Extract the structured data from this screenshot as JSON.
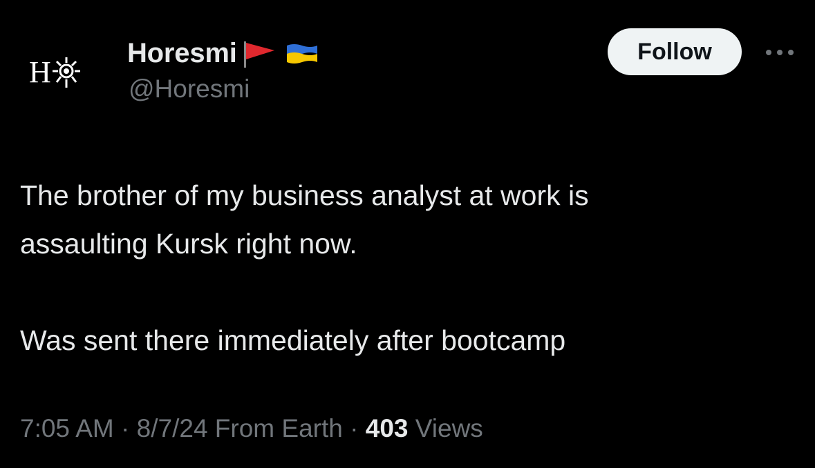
{
  "author": {
    "avatar_letter": "H",
    "display_name": "Horesmi",
    "handle": "@Horesmi",
    "name_emojis": [
      "red-triangular-flag",
      "ukraine-flag"
    ]
  },
  "follow_label": "Follow",
  "post": {
    "line1": "The brother of my business analyst at work is",
    "line2": "assaulting Kursk right now.",
    "line3": "Was sent there immediately after bootcamp"
  },
  "meta": {
    "time": "7:05 AM",
    "sep1": " · ",
    "date": "8/7/24",
    "location": " From Earth",
    "sep2": " · ",
    "views_count": "403",
    "views_label": " Views"
  },
  "colors": {
    "background": "#000000",
    "text_primary": "#e7e9ea",
    "text_secondary": "#71767b",
    "follow_bg": "#eff3f4",
    "follow_text": "#0f1419"
  }
}
